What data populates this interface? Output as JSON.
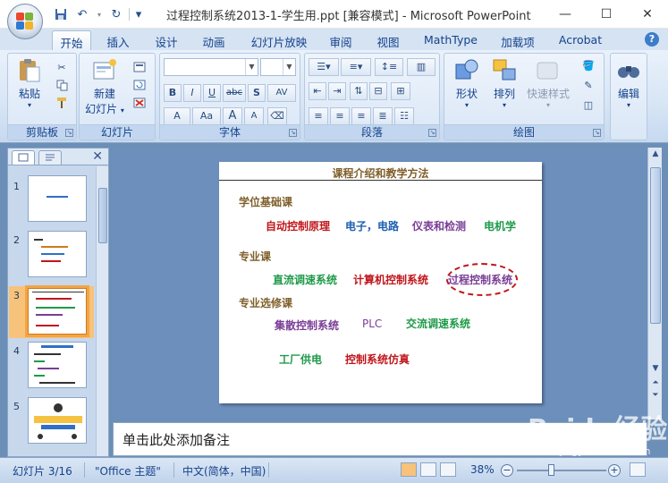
{
  "window": {
    "title": "过程控制系统2013-1-学生用.ppt [兼容模式] - Microsoft PowerPoint",
    "minimize": "—",
    "maximize": "☐",
    "close": "✕"
  },
  "qat": {
    "save": "💾",
    "undo": "↶",
    "redo": "↻",
    "more": "▾"
  },
  "tabs": [
    "开始",
    "插入",
    "设计",
    "动画",
    "幻灯片放映",
    "审阅",
    "视图",
    "MathType",
    "加载项",
    "Acrobat"
  ],
  "active_tab": "开始",
  "help": "?",
  "ribbon": {
    "clipboard": {
      "label": "剪贴板",
      "paste": "粘贴"
    },
    "slides": {
      "label": "幻灯片",
      "new_slide_line1": "新建",
      "new_slide_line2": "幻灯片"
    },
    "font": {
      "label": "字体",
      "bold": "B",
      "italic": "I",
      "underline": "U",
      "strike": "abc",
      "shadow": "S",
      "spacing": "AV",
      "aa": "Aa",
      "grow": "A",
      "shrink": "A"
    },
    "paragraph": {
      "label": "段落"
    },
    "drawing": {
      "label": "绘图",
      "shape": "形状",
      "arrange": "排列",
      "quick_styles": "快速样式"
    },
    "editing": {
      "label": "编辑",
      "edit": "编辑"
    }
  },
  "slide_pane": {
    "close": "✕",
    "thumbnails": [
      "1",
      "2",
      "3",
      "4",
      "5"
    ],
    "selected": "3"
  },
  "slide": {
    "title": "课程介绍和教学方法",
    "sections": {
      "basic": "学位基础课",
      "major": "专业课",
      "elective": "专业选修课"
    },
    "items": {
      "auto_control": "自动控制原理",
      "circuit": "电子，电路",
      "instrument": "仪表和检测",
      "motor": "电机学",
      "dc_speed": "直流调速系统",
      "computer_control": "计算机控制系统",
      "process_control": "过程控制系统",
      "dcs": "集散控制系统",
      "plc": "PLC",
      "ac_speed": "交流调速系统",
      "power_supply": "工厂供电",
      "simulation": "控制系统仿真"
    }
  },
  "notes": {
    "placeholder": "单击此处添加备注"
  },
  "status": {
    "slide_count": "幻灯片 3/16",
    "theme": "\"Office 主题\"",
    "language": "中文(简体，中国)",
    "zoom": "38%",
    "zoom_out": "−",
    "zoom_in": "+"
  },
  "watermark": {
    "main": "Baidu经验",
    "sub": "jingyan.baidu.com"
  },
  "colors": {
    "brown": "#7f5f2a",
    "red": "#c0161b",
    "blue": "#1f5fb0",
    "purple": "#7a3d96",
    "green": "#1f9a4a"
  }
}
